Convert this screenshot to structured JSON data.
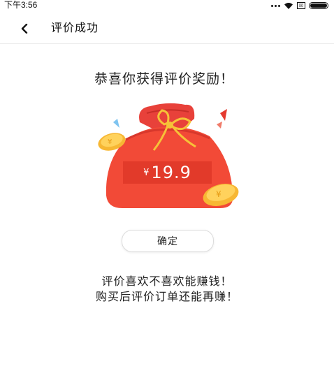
{
  "status_bar": {
    "time": "下午3:56",
    "sim_label": "☒"
  },
  "nav": {
    "title": "评价成功",
    "back_icon": "chevron-left-icon"
  },
  "main": {
    "congrats_text": "恭喜你获得评价奖励！",
    "reward": {
      "currency_symbol": "¥",
      "amount": "19.9"
    },
    "confirm_label": "确定",
    "promo_line1": "评价喜欢不喜欢能赚钱！",
    "promo_line2": "购买后评价订单还能再赚！"
  },
  "colors": {
    "bag_red": "#f24a37",
    "amount_bg": "#e23a2a",
    "coin_gold": "#f7b733",
    "ribbon_gold": "#f6c238"
  }
}
